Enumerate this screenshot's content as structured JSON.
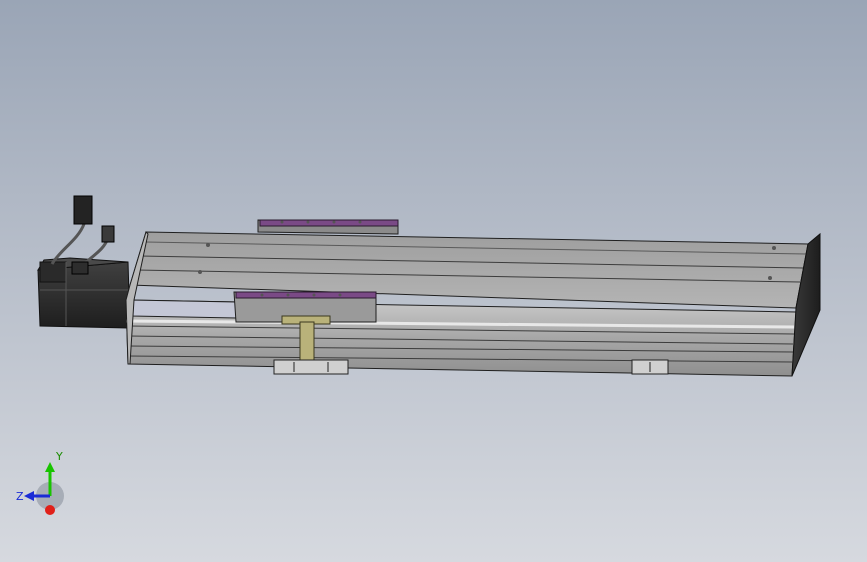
{
  "viewport": {
    "background_top": "#9aa5b6",
    "background_bottom": "#d6d9df",
    "background": "gradient"
  },
  "model": {
    "body_color": "#a9a9a9",
    "body_dark": "#5f5f5f",
    "edge_color": "#1f1f1f",
    "carriage_accent": "#7a4a86",
    "bracket_color": "#b9b27a",
    "motor_color": "#2e2e2e"
  },
  "triad": {
    "x_label": "",
    "y_label": "Y",
    "z_label": "Z",
    "y_color": "#18c400",
    "z_color": "#1a2bd6",
    "x_color": "#e0201a"
  }
}
